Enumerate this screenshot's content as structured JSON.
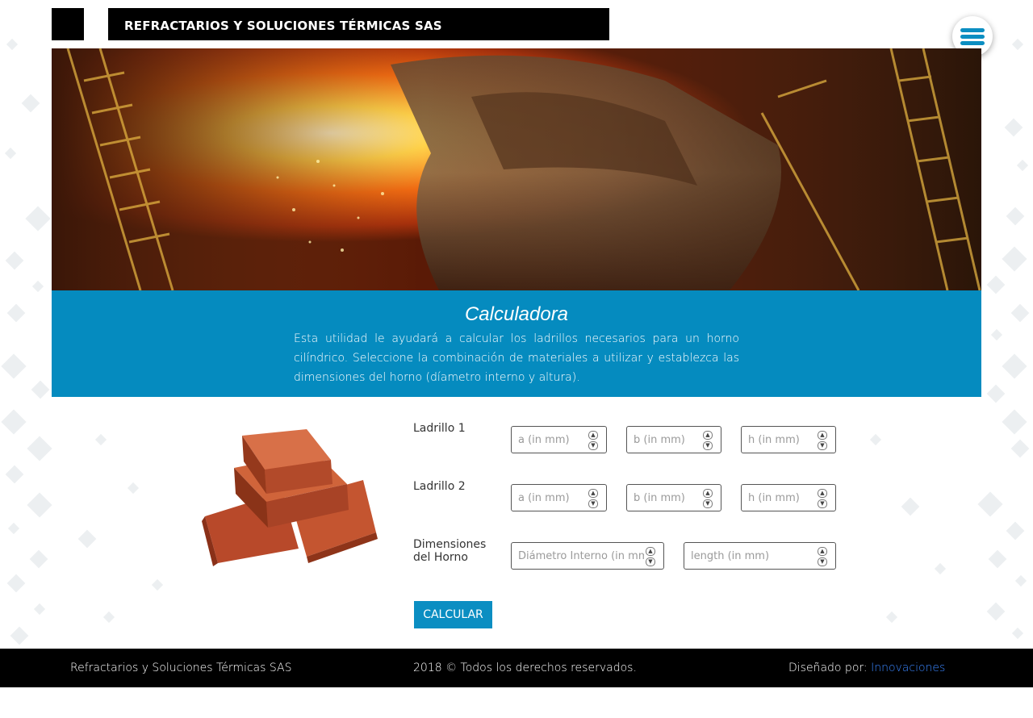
{
  "header": {
    "company_title": "REFRACTARIOS Y SOLUCIONES TÉRMICAS SAS",
    "menu_icon": "hamburger-menu-icon"
  },
  "hero": {
    "image": "steel-foundry-molten-metal"
  },
  "banner": {
    "title": "Calculadora",
    "description": "Esta utilidad le ayudará a calcular los ladrillos necesarios para un horno cilíndrico. Seleccione la combinación de materiales a utilizar y establezca las dimensiones del horno (díametro interno y altura)."
  },
  "form": {
    "brick_image": "stacked-red-bricks",
    "rows": [
      {
        "label": "Ladrillo 1",
        "fields": [
          {
            "placeholder": "a (in mm)",
            "value": ""
          },
          {
            "placeholder": "b (in mm)",
            "value": ""
          },
          {
            "placeholder": "h (in mm)",
            "value": ""
          }
        ]
      },
      {
        "label": "Ladrillo 2",
        "fields": [
          {
            "placeholder": "a (in mm)",
            "value": ""
          },
          {
            "placeholder": "b (in mm)",
            "value": ""
          },
          {
            "placeholder": "h (in mm)",
            "value": ""
          }
        ]
      },
      {
        "label_line1": "Dimensiones",
        "label_line2": "del Horno",
        "fields": [
          {
            "placeholder": "Diámetro Interno (in mm)",
            "value": ""
          },
          {
            "placeholder": "length (in mm)",
            "value": ""
          }
        ]
      }
    ],
    "submit_label": "CALCULAR"
  },
  "footer": {
    "company": "Refractarios y Soluciones Térmicas SAS",
    "copyright": "2018 © Todos los derechos reservados.",
    "designed_by_prefix": "Diseñado por: ",
    "designer_link": "Innovaciones"
  },
  "colors": {
    "accent": "#058bbf",
    "header_bg": "#000000",
    "link": "#3a86ff"
  }
}
